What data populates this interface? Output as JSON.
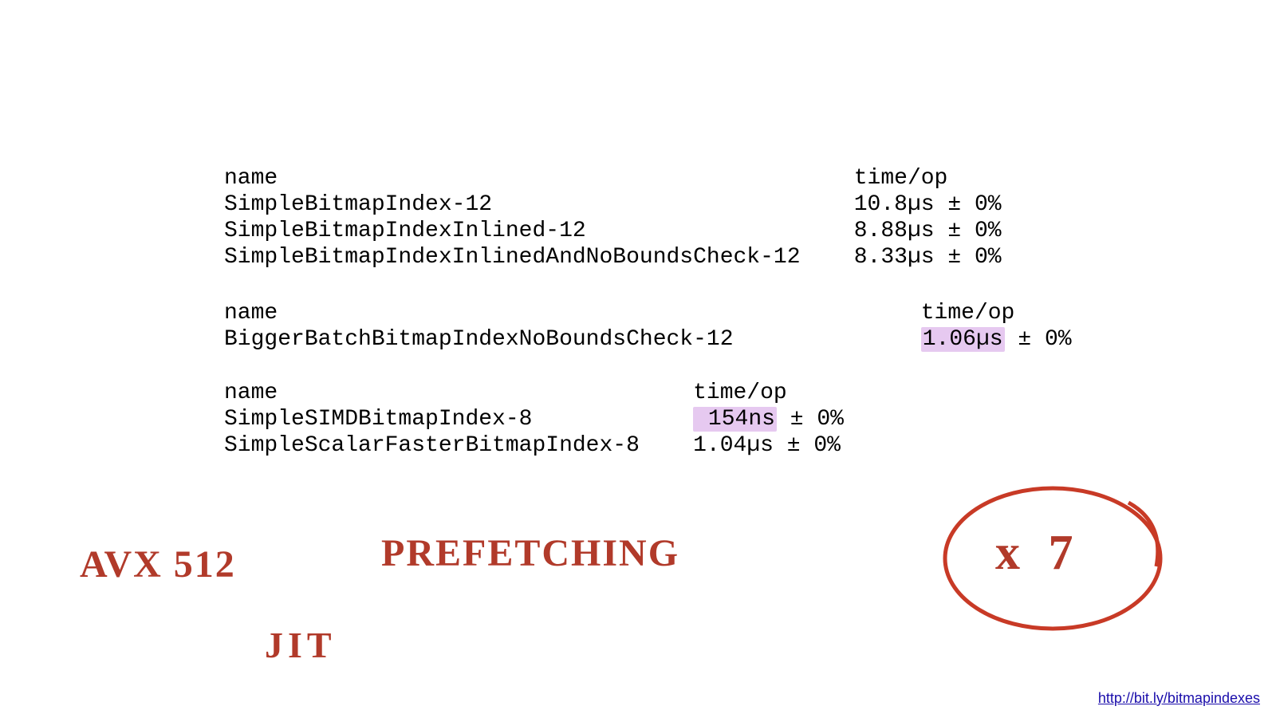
{
  "block1": {
    "header_name": "name",
    "header_time": "time/op",
    "rows": [
      {
        "name": "SimpleBitmapIndex-12",
        "time": "10.8µs ± 0%"
      },
      {
        "name": "SimpleBitmapIndexInlined-12",
        "time": "8.88µs ± 0%"
      },
      {
        "name": "SimpleBitmapIndexInlinedAndNoBoundsCheck-12",
        "time": "8.33µs ± 0%"
      }
    ],
    "name_width": 45
  },
  "block2": {
    "header_name": "name",
    "header_time": "time/op",
    "rows": [
      {
        "name": "BiggerBatchBitmapIndexNoBoundsCheck-12",
        "time_hl": "1.06µs",
        "time_rest": " ± 0%"
      }
    ],
    "name_width": 50
  },
  "block3": {
    "header_name": "name",
    "header_time": "time/op",
    "rows": [
      {
        "name": "SimpleSIMDBitmapIndex-8",
        "time_hl": " 154ns",
        "time_rest": " ± 0%"
      },
      {
        "name": "SimpleScalarFasterBitmapIndex-8",
        "time": "1.04µs ± 0%"
      }
    ],
    "name_width": 33
  },
  "annotations": {
    "avx": "AVX 512",
    "prefetching": "PREFETCHING",
    "jit": "JIT",
    "multiplier": "x 7"
  },
  "footer": {
    "url": "http://bit.ly/bitmapindexes"
  }
}
